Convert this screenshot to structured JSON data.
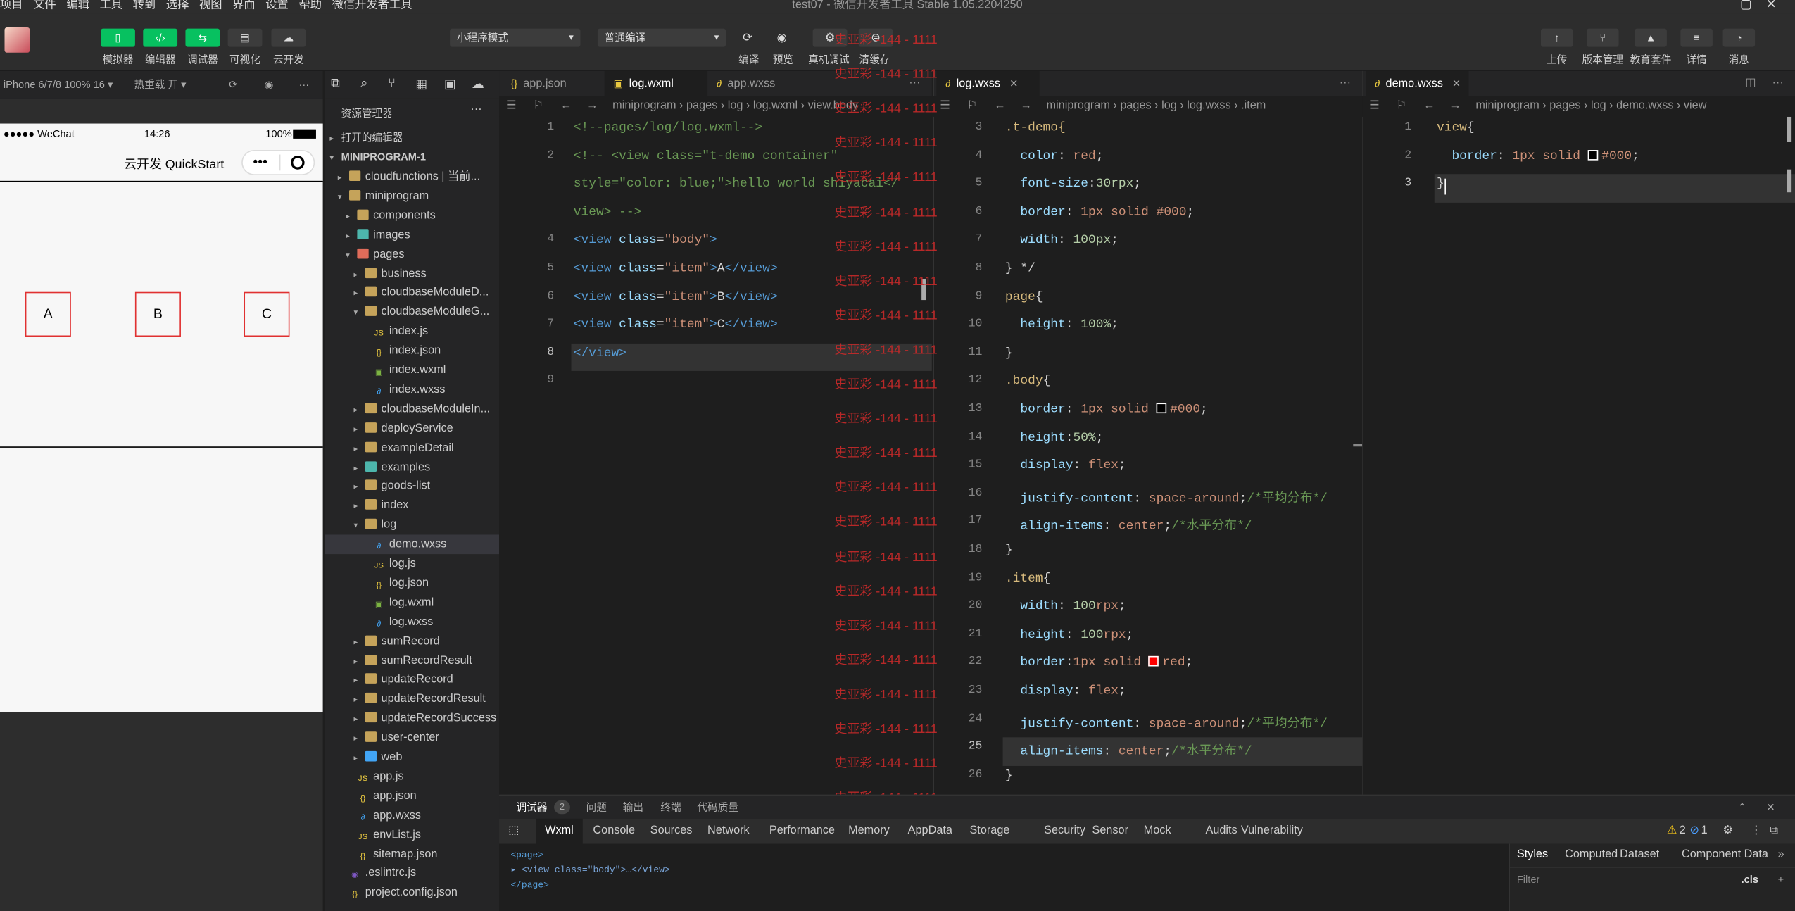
{
  "menubar": {
    "items": [
      "项目",
      "文件",
      "编辑",
      "工具",
      "转到",
      "选择",
      "视图",
      "界面",
      "设置",
      "帮助",
      "微信开发者工具"
    ],
    "window_title": "test07 - 微信开发者工具 Stable 1.05.2204250"
  },
  "toolbar": {
    "left_buttons": [
      "模拟器",
      "编辑器",
      "调试器",
      "可视化",
      "云开发"
    ],
    "mode_select": "小程序模式",
    "compile_select": "普通编译",
    "mid_buttons": [
      "编译",
      "预览",
      "真机调试",
      "清缓存"
    ],
    "right_buttons": [
      "上传",
      "版本管理",
      "教育套件",
      "详情",
      "消息"
    ]
  },
  "simulator": {
    "device": "iPhone 6/7/8 100% 16 ▾",
    "hotreload": "热重载 开 ▾",
    "status_carrier": "●●●●● WeChat",
    "status_time": "14:26",
    "status_battery": "100%",
    "nav_title": "云开发 QuickStart",
    "items": [
      "A",
      "B",
      "C"
    ]
  },
  "explorer": {
    "title": "资源管理器",
    "open_editors": "打开的编辑器",
    "project": "MINIPROGRAM-1",
    "rows": [
      {
        "label": "cloudfunctions | 当前...",
        "indent": 1,
        "type": "folder",
        "chev": "▸"
      },
      {
        "label": "miniprogram",
        "indent": 1,
        "type": "folder",
        "chev": "▾"
      },
      {
        "label": "components",
        "indent": 2,
        "type": "folder",
        "chev": "▸"
      },
      {
        "label": "images",
        "indent": 2,
        "type": "folder-img",
        "chev": "▸"
      },
      {
        "label": "pages",
        "indent": 2,
        "type": "folder-red",
        "chev": "▾"
      },
      {
        "label": "business",
        "indent": 3,
        "type": "folder",
        "chev": "▸"
      },
      {
        "label": "cloudbaseModuleD...",
        "indent": 3,
        "type": "folder",
        "chev": "▸"
      },
      {
        "label": "cloudbaseModuleG...",
        "indent": 3,
        "type": "folder",
        "chev": "▾"
      },
      {
        "label": "index.js",
        "indent": 4,
        "type": "js",
        "chev": ""
      },
      {
        "label": "index.json",
        "indent": 4,
        "type": "json",
        "chev": ""
      },
      {
        "label": "index.wxml",
        "indent": 4,
        "type": "wxml",
        "chev": ""
      },
      {
        "label": "index.wxss",
        "indent": 4,
        "type": "wxss",
        "chev": ""
      },
      {
        "label": "cloudbaseModuleIn...",
        "indent": 3,
        "type": "folder",
        "chev": "▸"
      },
      {
        "label": "deployService",
        "indent": 3,
        "type": "folder",
        "chev": "▸"
      },
      {
        "label": "exampleDetail",
        "indent": 3,
        "type": "folder",
        "chev": "▸"
      },
      {
        "label": "examples",
        "indent": 3,
        "type": "folder-img",
        "chev": "▸"
      },
      {
        "label": "goods-list",
        "indent": 3,
        "type": "folder",
        "chev": "▸"
      },
      {
        "label": "index",
        "indent": 3,
        "type": "folder",
        "chev": "▸"
      },
      {
        "label": "log",
        "indent": 3,
        "type": "folder",
        "chev": "▾"
      },
      {
        "label": "demo.wxss",
        "indent": 4,
        "type": "wxss",
        "chev": "",
        "selected": true
      },
      {
        "label": "log.js",
        "indent": 4,
        "type": "js",
        "chev": ""
      },
      {
        "label": "log.json",
        "indent": 4,
        "type": "json",
        "chev": ""
      },
      {
        "label": "log.wxml",
        "indent": 4,
        "type": "wxml",
        "chev": ""
      },
      {
        "label": "log.wxss",
        "indent": 4,
        "type": "wxss",
        "chev": ""
      },
      {
        "label": "sumRecord",
        "indent": 3,
        "type": "folder",
        "chev": "▸"
      },
      {
        "label": "sumRecordResult",
        "indent": 3,
        "type": "folder",
        "chev": "▸"
      },
      {
        "label": "updateRecord",
        "indent": 3,
        "type": "folder",
        "chev": "▸"
      },
      {
        "label": "updateRecordResult",
        "indent": 3,
        "type": "folder",
        "chev": "▸"
      },
      {
        "label": "updateRecordSuccess",
        "indent": 3,
        "type": "folder",
        "chev": "▸"
      },
      {
        "label": "user-center",
        "indent": 3,
        "type": "folder",
        "chev": "▸"
      },
      {
        "label": "web",
        "indent": 3,
        "type": "folder-blue",
        "chev": "▸"
      },
      {
        "label": "app.js",
        "indent": 2,
        "type": "js",
        "chev": ""
      },
      {
        "label": "app.json",
        "indent": 2,
        "type": "json",
        "chev": ""
      },
      {
        "label": "app.wxss",
        "indent": 2,
        "type": "wxss",
        "chev": ""
      },
      {
        "label": "envList.js",
        "indent": 2,
        "type": "js",
        "chev": ""
      },
      {
        "label": "sitemap.json",
        "indent": 2,
        "type": "json",
        "chev": ""
      },
      {
        "label": ".eslintrc.js",
        "indent": 1,
        "type": "eslint",
        "chev": ""
      },
      {
        "label": "project.config.json",
        "indent": 1,
        "type": "json",
        "chev": ""
      }
    ]
  },
  "editor1": {
    "tabs": [
      "app.json",
      "log.wxml",
      "app.wxss"
    ],
    "breadcrumbs": "miniprogram  ›  pages  ›  log  ›  log.wxml  ›  view.body",
    "lines": [
      {
        "n": "1",
        "tokens": [
          [
            "<!--pages/log/log.wxml-->",
            "com"
          ]
        ]
      },
      {
        "n": "2",
        "tokens": [
          [
            "<!-- <view class=\"t-demo container\"",
            "com"
          ]
        ]
      },
      {
        "n": "",
        "tokens": [
          [
            "style=\"color: blue;\">hello world shiyacai</",
            "com"
          ]
        ]
      },
      {
        "n": "",
        "tokens": [
          [
            "view> -->",
            "com"
          ]
        ]
      },
      {
        "n": "4",
        "tokens": [
          [
            "<view ",
            "tag"
          ],
          [
            "class",
            "attr"
          ],
          [
            "=",
            "txt"
          ],
          [
            "\"body\"",
            "str"
          ],
          [
            ">",
            "tag"
          ]
        ]
      },
      {
        "n": "5",
        "tokens": [
          [
            "<view ",
            "tag"
          ],
          [
            "class",
            "attr"
          ],
          [
            "=",
            "txt"
          ],
          [
            "\"item\"",
            "str"
          ],
          [
            ">",
            "tag"
          ],
          [
            "A",
            "txt"
          ],
          [
            "</view>",
            "tag"
          ]
        ]
      },
      {
        "n": "6",
        "tokens": [
          [
            "<view ",
            "tag"
          ],
          [
            "class",
            "attr"
          ],
          [
            "=",
            "txt"
          ],
          [
            "\"item\"",
            "str"
          ],
          [
            ">",
            "tag"
          ],
          [
            "B",
            "txt"
          ],
          [
            "</view>",
            "tag"
          ]
        ]
      },
      {
        "n": "7",
        "tokens": [
          [
            "<view ",
            "tag"
          ],
          [
            "class",
            "attr"
          ],
          [
            "=",
            "txt"
          ],
          [
            "\"item\"",
            "str"
          ],
          [
            ">",
            "tag"
          ],
          [
            "C",
            "txt"
          ],
          [
            "</view>",
            "tag"
          ]
        ]
      },
      {
        "n": "8",
        "tokens": [
          [
            "</view>",
            "tag"
          ]
        ]
      },
      {
        "n": "9",
        "tokens": []
      }
    ]
  },
  "editor2": {
    "tabs": [
      "log.wxss"
    ],
    "breadcrumbs": "miniprogram  ›  pages  ›  log  ›  log.wxss  ›  .item",
    "lines": [
      {
        "n": "3",
        "tokens": [
          [
            ".t-demo{",
            "sel"
          ]
        ]
      },
      {
        "n": "4",
        "tokens": [
          [
            "  color",
            "prop"
          ],
          [
            ": ",
            "pun"
          ],
          [
            "red",
            "val"
          ],
          [
            ";",
            "pun"
          ]
        ]
      },
      {
        "n": "5",
        "tokens": [
          [
            "  font-size",
            "prop"
          ],
          [
            ":",
            "pun"
          ],
          [
            "30rpx",
            "num"
          ],
          [
            ";",
            "pun"
          ]
        ]
      },
      {
        "n": "6",
        "tokens": [
          [
            "  border",
            "prop"
          ],
          [
            ": ",
            "pun"
          ],
          [
            "1px solid #000",
            "val"
          ],
          [
            ";",
            "pun"
          ]
        ]
      },
      {
        "n": "7",
        "tokens": [
          [
            "  width",
            "prop"
          ],
          [
            ": ",
            "pun"
          ],
          [
            "100px",
            "num"
          ],
          [
            ";",
            "pun"
          ]
        ]
      },
      {
        "n": "8",
        "tokens": [
          [
            "} */",
            "pun"
          ]
        ]
      },
      {
        "n": "9",
        "tokens": [
          [
            "page",
            "sel"
          ],
          [
            "{",
            "pun"
          ]
        ]
      },
      {
        "n": "10",
        "tokens": [
          [
            "  height",
            "prop"
          ],
          [
            ": ",
            "pun"
          ],
          [
            "100%",
            "num"
          ],
          [
            ";",
            "pun"
          ]
        ]
      },
      {
        "n": "11",
        "tokens": [
          [
            "}",
            "pun"
          ]
        ]
      },
      {
        "n": "12",
        "tokens": [
          [
            ".body",
            "sel"
          ],
          [
            "{",
            "pun"
          ]
        ]
      },
      {
        "n": "13",
        "tokens": [
          [
            "  border",
            "prop"
          ],
          [
            ": ",
            "pun"
          ],
          [
            "1px solid ",
            "val"
          ],
          [
            "■",
            "swatch-black"
          ],
          [
            "#000",
            "val"
          ],
          [
            ";",
            "pun"
          ]
        ]
      },
      {
        "n": "14",
        "tokens": [
          [
            "  height",
            "prop"
          ],
          [
            ":",
            "pun"
          ],
          [
            "50%",
            "num"
          ],
          [
            ";",
            "pun"
          ]
        ]
      },
      {
        "n": "15",
        "tokens": [
          [
            "  display",
            "prop"
          ],
          [
            ": ",
            "pun"
          ],
          [
            "flex",
            "val"
          ],
          [
            ";",
            "pun"
          ]
        ]
      },
      {
        "n": "16",
        "tokens": [
          [
            "  justify-content",
            "prop"
          ],
          [
            ": ",
            "pun"
          ],
          [
            "space-around",
            "val"
          ],
          [
            ";",
            "pun"
          ],
          [
            "/*平均分布*/",
            "com"
          ]
        ]
      },
      {
        "n": "17",
        "tokens": [
          [
            "  align-items",
            "prop"
          ],
          [
            ": ",
            "pun"
          ],
          [
            "center",
            "val"
          ],
          [
            ";",
            "pun"
          ],
          [
            "/*水平分布*/",
            "com"
          ]
        ]
      },
      {
        "n": "18",
        "tokens": [
          [
            "}",
            "pun"
          ]
        ]
      },
      {
        "n": "19",
        "tokens": [
          [
            ".item",
            "sel"
          ],
          [
            "{",
            "pun"
          ]
        ]
      },
      {
        "n": "20",
        "tokens": [
          [
            "  width",
            "prop"
          ],
          [
            ": ",
            "pun"
          ],
          [
            "100",
            "num"
          ],
          [
            "rpx",
            "val"
          ],
          [
            ";",
            "pun"
          ]
        ]
      },
      {
        "n": "21",
        "tokens": [
          [
            "  height",
            "prop"
          ],
          [
            ": ",
            "pun"
          ],
          [
            "100",
            "num"
          ],
          [
            "rpx",
            "val"
          ],
          [
            ";",
            "pun"
          ]
        ]
      },
      {
        "n": "22",
        "tokens": [
          [
            "  border",
            "prop"
          ],
          [
            ":",
            "pun"
          ],
          [
            "1px solid ",
            "val"
          ],
          [
            "■",
            "swatch-red"
          ],
          [
            "red",
            "val"
          ],
          [
            ";",
            "pun"
          ]
        ]
      },
      {
        "n": "23",
        "tokens": [
          [
            "  display",
            "prop"
          ],
          [
            ": ",
            "pun"
          ],
          [
            "flex",
            "val"
          ],
          [
            ";",
            "pun"
          ]
        ]
      },
      {
        "n": "24",
        "tokens": [
          [
            "  justify-content",
            "prop"
          ],
          [
            ": ",
            "pun"
          ],
          [
            "space-around",
            "val"
          ],
          [
            ";",
            "pun"
          ],
          [
            "/*平均分布*/",
            "com"
          ]
        ]
      },
      {
        "n": "25",
        "tokens": [
          [
            "  align-items",
            "prop"
          ],
          [
            ": ",
            "pun"
          ],
          [
            "center",
            "val"
          ],
          [
            ";",
            "pun"
          ],
          [
            "/*水平分布*/",
            "com"
          ]
        ]
      },
      {
        "n": "26",
        "tokens": [
          [
            "}",
            "pun"
          ]
        ]
      }
    ]
  },
  "editor3": {
    "tabs": [
      "demo.wxss"
    ],
    "breadcrumbs": "miniprogram  ›  pages  ›  log  ›  demo.wxss  ›  view",
    "lines": [
      {
        "n": "1",
        "tokens": [
          [
            "view",
            "sel"
          ],
          [
            "{",
            "pun"
          ]
        ]
      },
      {
        "n": "2",
        "tokens": [
          [
            "  border",
            "prop"
          ],
          [
            ": ",
            "pun"
          ],
          [
            "1px solid ",
            "val"
          ],
          [
            "■",
            "swatch-black"
          ],
          [
            "#000",
            "val"
          ],
          [
            ";",
            "pun"
          ]
        ]
      },
      {
        "n": "3",
        "tokens": [
          [
            "}",
            "pun"
          ]
        ]
      }
    ]
  },
  "watermark": "史亚彩 -144 - 1111",
  "devtools": {
    "top_tabs": [
      "调试器",
      "2",
      "问题",
      "输出",
      "终端",
      "代码质量"
    ],
    "tabs": [
      "Wxml",
      "Console",
      "Sources",
      "Network",
      "Performance",
      "Memory",
      "AppData",
      "Storage",
      "Security",
      "Sensor",
      "Mock",
      "Audits",
      "Vulnerability"
    ],
    "warn_count": "2",
    "err_count": "1",
    "tree": [
      "<page>",
      "▸ <view class=\"body\">…</view>",
      "</page>"
    ],
    "style_tabs": [
      "Styles",
      "Computed",
      "Dataset",
      "Component Data"
    ],
    "filter_placeholder": "Filter",
    "cls": ".cls"
  },
  "colors": {
    "accent": "#07c160",
    "red": "#c92a2a"
  }
}
